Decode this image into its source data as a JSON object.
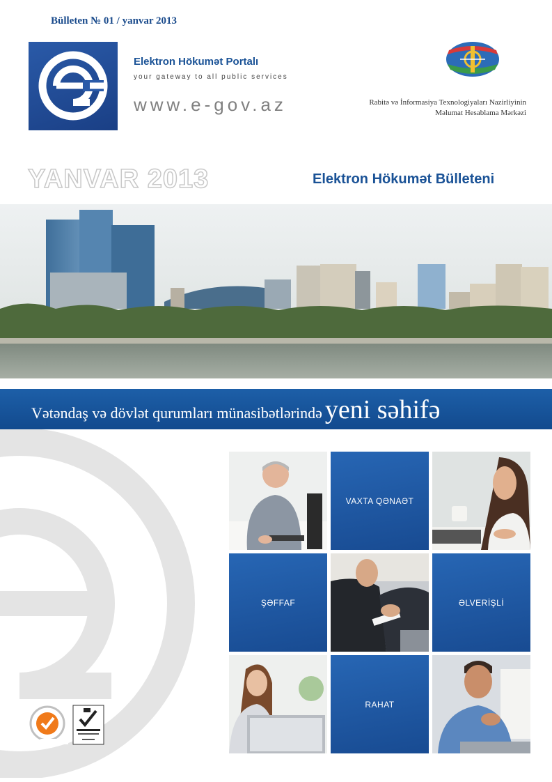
{
  "header": {
    "bulletin_number": "Bülleten № 01 / yanvar 2013",
    "portal_name": "Elektron Hökumət Portalı",
    "tagline": "your gateway to all public services",
    "url": "www.e-gov.az",
    "ministry_line1": "Rabitə və İnformasiya Texnologiyaları Nazirliyinin",
    "ministry_line2": "Məlumat Hesablama Mərkəzi"
  },
  "title_row": {
    "month_year": "YANVAR 2013",
    "bulletin_title": "Elektron Hökumət Bülleteni"
  },
  "slogan": {
    "main": "Vətəndaş və dövlət qurumları münasibətlərində",
    "emphasis": "yeni səhifə"
  },
  "tiles": [
    {
      "type": "photo",
      "icon": "man-at-computer-photo"
    },
    {
      "type": "label",
      "label": "VAXTA QƏNAƏT"
    },
    {
      "type": "photo",
      "icon": "woman-on-phone-photo"
    },
    {
      "type": "label",
      "label": "ŞƏFFAF"
    },
    {
      "type": "photo",
      "icon": "business-handshake-photo"
    },
    {
      "type": "label",
      "label": "ƏLVERİŞLİ"
    },
    {
      "type": "photo",
      "icon": "woman-with-laptop-photo"
    },
    {
      "type": "label",
      "label": "RAHAT"
    },
    {
      "type": "photo",
      "icon": "smiling-man-photo"
    }
  ],
  "colors": {
    "brand_blue": "#1a5296",
    "band_blue": "#124a8e",
    "grey_text": "#808080"
  }
}
